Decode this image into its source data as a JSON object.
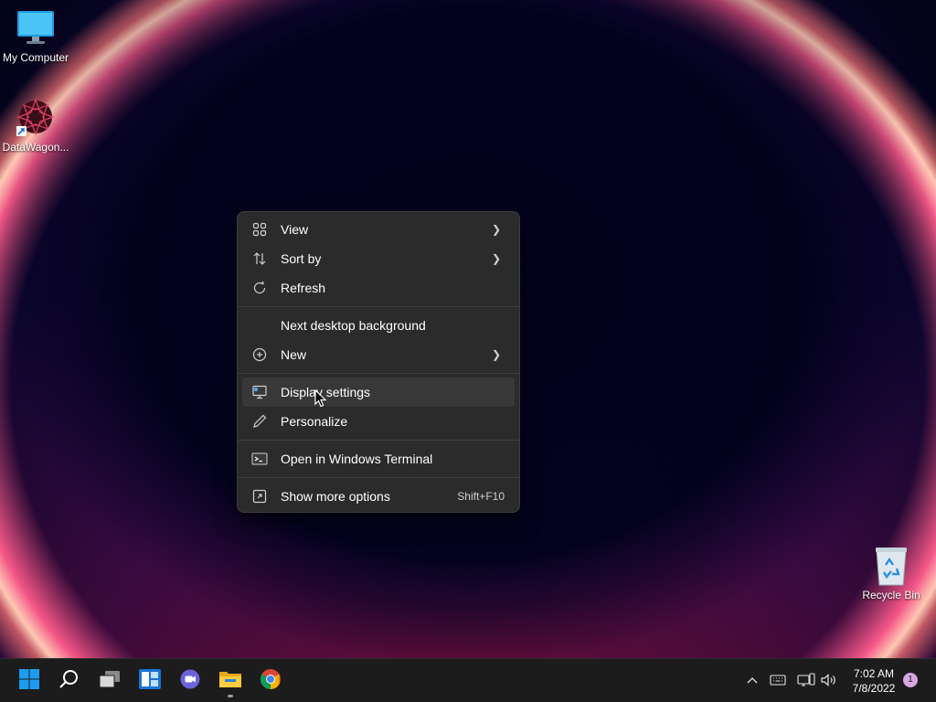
{
  "desktop": {
    "icons": [
      {
        "label": "My Computer",
        "icon": "monitor-icon"
      },
      {
        "label": "DataWagon...",
        "icon": "datawagon-icon"
      },
      {
        "label": "Recycle Bin",
        "icon": "recycle-bin-icon"
      }
    ]
  },
  "context_menu": {
    "items": [
      {
        "label": "View",
        "icon": "grid-icon",
        "submenu": true
      },
      {
        "label": "Sort by",
        "icon": "sort-icon",
        "submenu": true
      },
      {
        "label": "Refresh",
        "icon": "refresh-icon",
        "submenu": false
      },
      {
        "label": "Next desktop background",
        "icon": "",
        "submenu": false
      },
      {
        "label": "New",
        "icon": "plus-circle-icon",
        "submenu": true
      },
      {
        "label": "Display settings",
        "icon": "display-icon",
        "submenu": false
      },
      {
        "label": "Personalize",
        "icon": "pen-icon",
        "submenu": false
      },
      {
        "label": "Open in Windows Terminal",
        "icon": "terminal-icon",
        "submenu": false
      },
      {
        "label": "Show more options",
        "icon": "expand-icon",
        "submenu": false,
        "shortcut": "Shift+F10"
      }
    ],
    "hovered_item": "Display settings"
  },
  "taskbar": {
    "apps": [
      "start-icon",
      "search-icon",
      "task-view-icon",
      "widgets-icon",
      "teams-chat-icon",
      "file-explorer-icon",
      "chrome-icon"
    ],
    "clock": {
      "time": "7:02 AM",
      "date": "7/8/2022"
    },
    "notification_count": "1"
  },
  "colors": {
    "menu_bg": "#2b2b2b",
    "menu_hover": "#383838",
    "taskbar_bg": "#1c1c1c",
    "accent_blue": "#0a84e6"
  }
}
